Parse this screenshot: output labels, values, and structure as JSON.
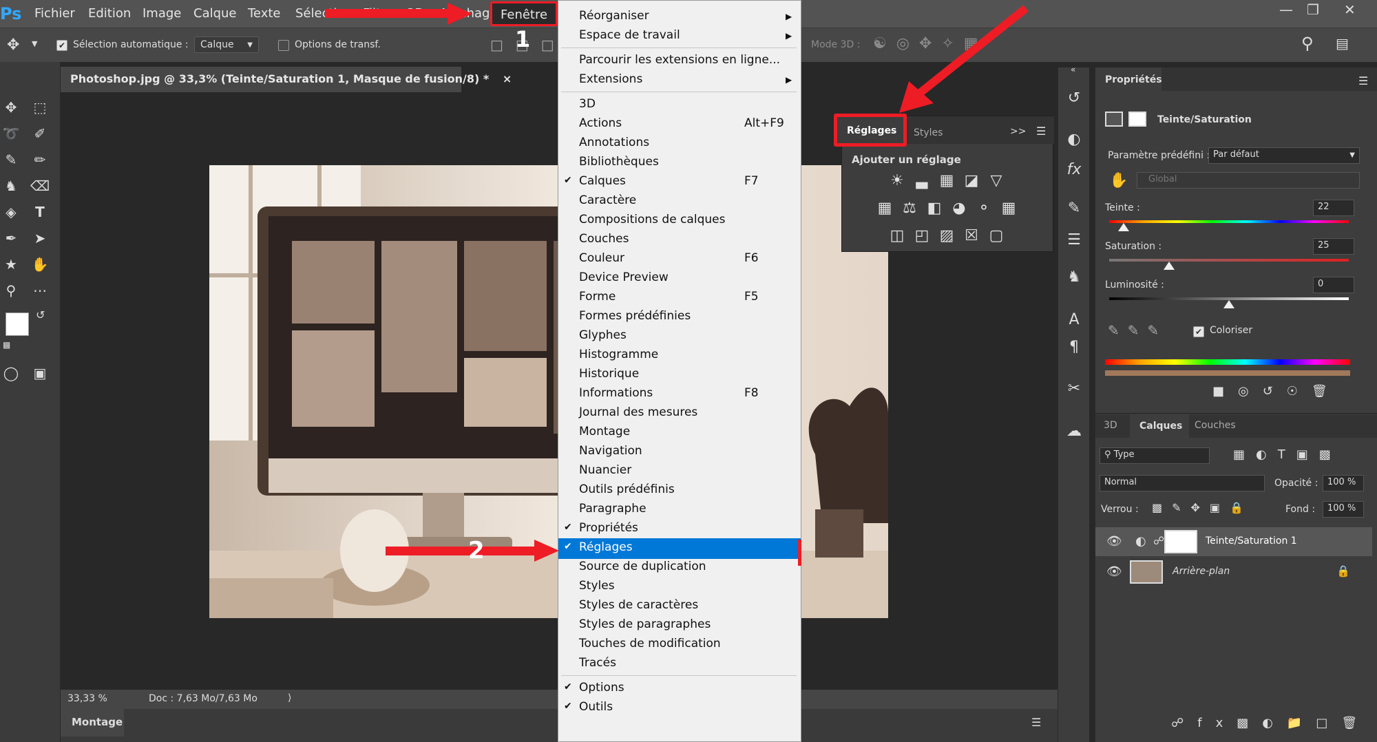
{
  "app": {
    "logo": "Ps"
  },
  "menubar": {
    "items": [
      "Fichier",
      "Edition",
      "Image",
      "Calque",
      "Texte",
      "Sélection",
      "Filtre",
      "3D",
      "Affichage",
      "Fenêtre"
    ],
    "active": "Fenêtre"
  },
  "options": {
    "auto_select_label": "Sélection automatique :",
    "auto_select_value": "Calque",
    "transform_label": "Options de transf.",
    "mode3d_label": "Mode 3D :"
  },
  "document": {
    "tab_title": "Photoshop.jpg @ 33,3% (Teinte/Saturation 1, Masque de fusion/8) *",
    "close": "×",
    "zoom": "33,33 %",
    "doc_info": "Doc : 7,63 Mo/7,63 Mo",
    "montage_tab": "Montage"
  },
  "window_menu": {
    "items": [
      {
        "label": "Réorganiser",
        "submenu": true
      },
      {
        "label": "Espace de travail",
        "submenu": true
      },
      {
        "label": "Parcourir les extensions en ligne..."
      },
      {
        "label": "Extensions",
        "submenu": true
      },
      {
        "label": "3D"
      },
      {
        "label": "Actions",
        "shortcut": "Alt+F9"
      },
      {
        "label": "Annotations"
      },
      {
        "label": "Bibliothèques"
      },
      {
        "label": "Calques",
        "shortcut": "F7",
        "checked": true
      },
      {
        "label": "Caractère"
      },
      {
        "label": "Compositions de calques"
      },
      {
        "label": "Couches"
      },
      {
        "label": "Couleur",
        "shortcut": "F6"
      },
      {
        "label": "Device Preview"
      },
      {
        "label": "Forme",
        "shortcut": "F5"
      },
      {
        "label": "Formes prédéfinies"
      },
      {
        "label": "Glyphes"
      },
      {
        "label": "Histogramme"
      },
      {
        "label": "Historique"
      },
      {
        "label": "Informations",
        "shortcut": "F8"
      },
      {
        "label": "Journal des mesures"
      },
      {
        "label": "Montage"
      },
      {
        "label": "Navigation"
      },
      {
        "label": "Nuancier"
      },
      {
        "label": "Outils prédéfinis"
      },
      {
        "label": "Paragraphe"
      },
      {
        "label": "Propriétés",
        "checked": true
      },
      {
        "label": "Réglages",
        "checked": true,
        "highlighted": true
      },
      {
        "label": "Source de duplication"
      },
      {
        "label": "Styles"
      },
      {
        "label": "Styles de caractères"
      },
      {
        "label": "Styles de paragraphes"
      },
      {
        "label": "Touches de modification"
      },
      {
        "label": "Tracés"
      },
      {
        "label": "Options",
        "checked": true
      },
      {
        "label": "Outils",
        "checked": true
      }
    ]
  },
  "annotations": {
    "step1": "1",
    "step2": "2"
  },
  "adjustments_panel": {
    "tabs": [
      "Réglages",
      "Styles"
    ],
    "expand": ">>",
    "heading": "Ajouter un réglage"
  },
  "properties": {
    "title": "Propriétés",
    "layer_type": "Teinte/Saturation",
    "preset_label": "Paramètre prédéfini :",
    "preset_value": "Par défaut",
    "channel": "Global",
    "hue_label": "Teinte :",
    "hue_value": "22",
    "sat_label": "Saturation :",
    "sat_value": "25",
    "light_label": "Luminosité :",
    "light_value": "0",
    "colorize_label": "Coloriser",
    "hue_level": 0.06,
    "sat_level": 0.25,
    "light_level": 0.5
  },
  "layers": {
    "tabs": [
      "3D",
      "Calques",
      "Couches"
    ],
    "filter": "Type",
    "blend": "Normal",
    "opacity_label": "Opacité :",
    "opacity_value": "100 %",
    "lock_label": "Verrou :",
    "fill_label": "Fond :",
    "fill_value": "100 %",
    "items": [
      {
        "name": "Teinte/Saturation 1"
      },
      {
        "name": "Arrière-plan"
      }
    ]
  },
  "colors": {
    "highlight": "#0078d7",
    "annot_red": "#ee1c25"
  }
}
